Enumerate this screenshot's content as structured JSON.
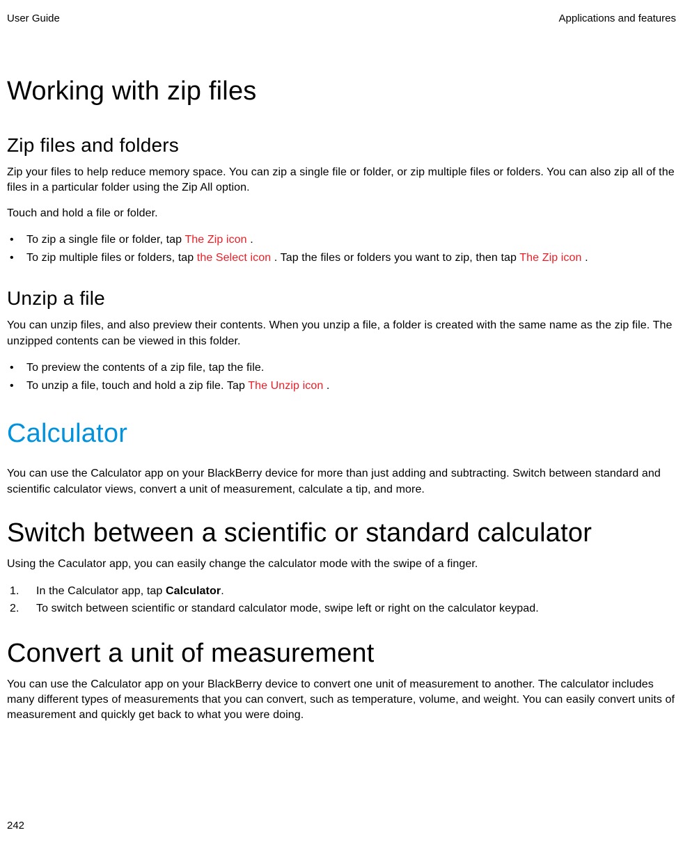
{
  "header": {
    "left": "User Guide",
    "right": "Applications and features"
  },
  "sections": {
    "title1": "Working with zip files",
    "zip_h2": "Zip files and folders",
    "zip_p1": "Zip your files to help reduce memory space. You can zip a single file or folder, or zip multiple files or folders. You can also zip all of the files in a particular folder using the Zip All option.",
    "zip_p2": "Touch and hold a file or folder.",
    "zip_li1_a": "To zip a single file or folder, tap ",
    "zip_li1_b": " The Zip icon ",
    "zip_li1_c": ".",
    "zip_li2_a": "To zip multiple files or folders, tap ",
    "zip_li2_b": " the Select icon ",
    "zip_li2_c": ". Tap the files or folders you want to zip, then tap ",
    "zip_li2_d": " The Zip icon ",
    "zip_li2_e": ".",
    "unzip_h2": "Unzip a file",
    "unzip_p1": "You can unzip files, and also preview their contents. When you unzip a file, a folder is created with the same name as the zip file. The unzipped contents can be viewed in this folder.",
    "unzip_li1": "To preview the contents of a zip file, tap the file.",
    "unzip_li2_a": "To unzip a file, touch and hold a zip file. Tap ",
    "unzip_li2_b": " The Unzip icon ",
    "unzip_li2_c": ".",
    "calc_chapter": "Calculator",
    "calc_p1": "You can use the Calculator app on your BlackBerry device for more than just adding and subtracting. Switch between standard and scientific calculator views, convert a unit of measurement, calculate a tip, and more.",
    "switch_h2": "Switch between a scientific or standard calculator",
    "switch_p1": "Using the Caculator app, you can easily change the calculator mode with the swipe of a finger.",
    "switch_li1_a": "In the Calculator app, tap ",
    "switch_li1_b": "Calculator",
    "switch_li1_c": ".",
    "switch_li2": "To switch between scientific or standard calculator mode, swipe left or right on the calculator keypad.",
    "convert_h2": "Convert a unit of measurement",
    "convert_p1": "You can use the Calculator app on your BlackBerry device to convert one unit of measurement to another. The calculator includes many different types of measurements that you can convert, such as temperature, volume, and weight. You can easily convert units of measurement and quickly get back to what you were doing."
  },
  "page_number": "242"
}
